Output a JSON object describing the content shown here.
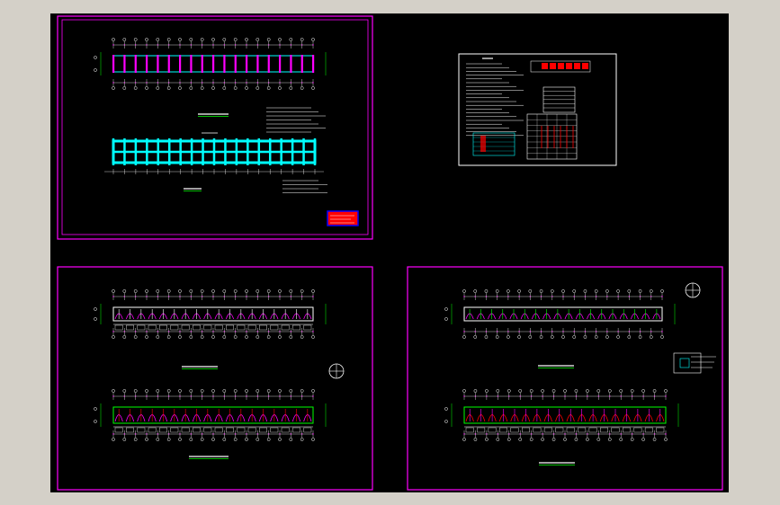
{
  "canvas": {
    "background": "#000000",
    "outer_background": "#d4d0c8"
  },
  "colors": {
    "border": "#ff00ff",
    "axis": "#ffffff",
    "wall": "#00ffff",
    "beam": "#ff00ff",
    "dim": "#00ff00",
    "rebar": "#ff0000",
    "text": "#ffffff",
    "note": "#ffff00"
  },
  "sheets": [
    {
      "id": "top-left",
      "kind": "foundation-plan"
    },
    {
      "id": "top-right",
      "kind": "design-notes-and-tables"
    },
    {
      "id": "bottom-left",
      "kind": "floor-slab-reinforcement-plans"
    },
    {
      "id": "bottom-right",
      "kind": "roof-slab-reinforcement-plans"
    }
  ],
  "axis_bubble_count": 19,
  "legend_stamp": {
    "fill": "#ff0000",
    "border": "#0000ff"
  }
}
